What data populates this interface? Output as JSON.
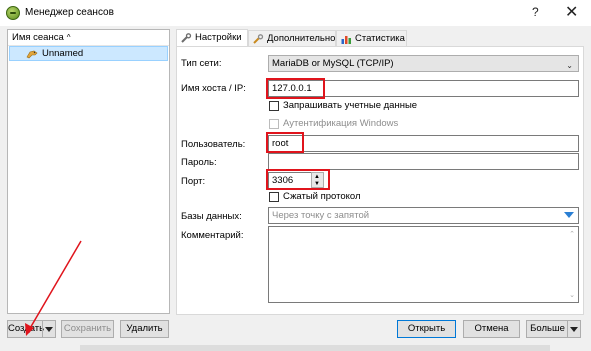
{
  "window": {
    "title": "Менеджер сеансов",
    "help": "?",
    "close": "✕"
  },
  "session_list": {
    "header": "Имя сеанса",
    "sort_indicator": "^",
    "items": [
      {
        "label": "Unnamed",
        "selected": true
      }
    ]
  },
  "tabs": [
    {
      "label": "Настройки",
      "active": true,
      "icon": "wrench-icon"
    },
    {
      "label": "Дополнительно",
      "active": false,
      "icon": "wrench-advanced-icon"
    },
    {
      "label": "Статистика",
      "active": false,
      "icon": "bar-chart-icon"
    }
  ],
  "settings": {
    "network_type_label": "Тип сети:",
    "network_type_value": "MariaDB or MySQL (TCP/IP)",
    "host_label": "Имя хоста / IP:",
    "host_value": "127.0.0.1",
    "prompt_credentials_label": "Запрашивать учетные данные",
    "prompt_credentials_checked": false,
    "windows_auth_label": "Аутентификация Windows",
    "windows_auth_enabled": false,
    "user_label": "Пользователь:",
    "user_value": "root",
    "password_label": "Пароль:",
    "password_value": "",
    "port_label": "Порт:",
    "port_value": "3306",
    "compressed_label": "Сжатый протокол",
    "compressed_checked": false,
    "databases_label": "Базы данных:",
    "databases_placeholder": "Через точку с запятой",
    "comment_label": "Комментарий:",
    "comment_value": ""
  },
  "buttons": {
    "create": "Создать",
    "save": "Сохранить",
    "delete": "Удалить",
    "open": "Открыть",
    "cancel": "Отмена",
    "more": "Больше"
  },
  "colors": {
    "highlight": "#e0141c",
    "selection": "#cce8ff",
    "accent": "#0078d7"
  }
}
